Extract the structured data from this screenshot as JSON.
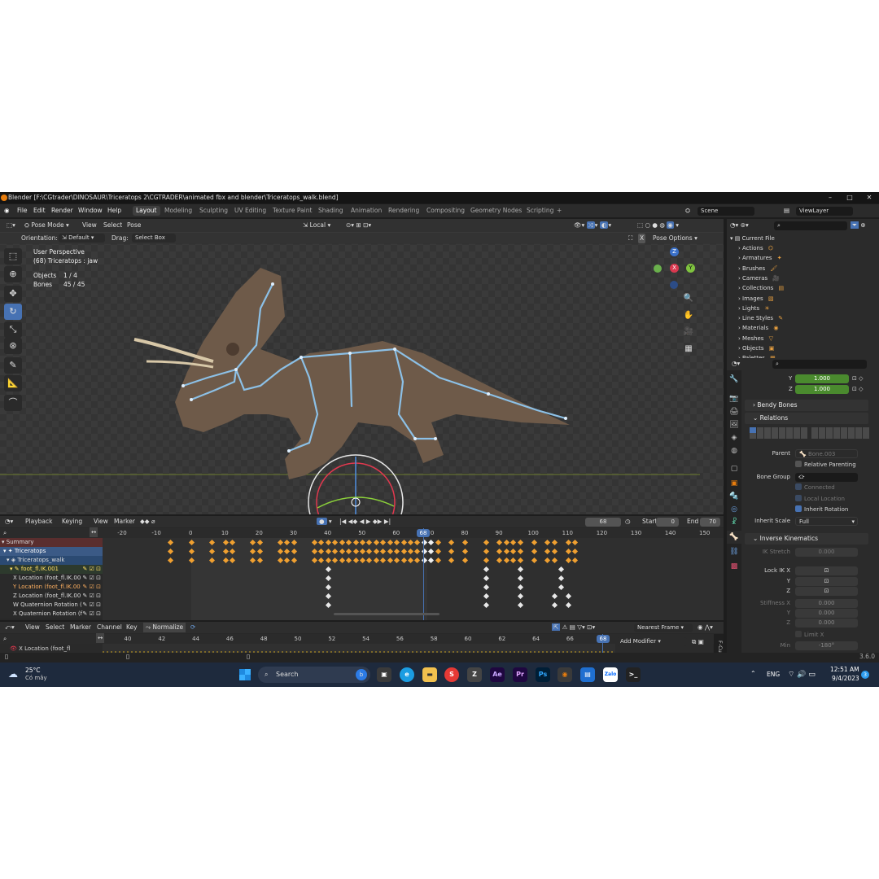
{
  "window": {
    "title": "Blender [F:\\CGtrader\\DINOSAUR\\Triceratops 2\\CGTRADER\\animated fbx and blender\\Triceratops_walk.blend]",
    "min": "–",
    "max": "□",
    "close": "✕"
  },
  "menu": [
    "File",
    "Edit",
    "Render",
    "Window",
    "Help"
  ],
  "workspaces": [
    "Layout",
    "Modeling",
    "Sculpting",
    "UV Editing",
    "Texture Paint",
    "Shading",
    "Animation",
    "Rendering",
    "Compositing",
    "Geometry Nodes",
    "Scripting",
    "+"
  ],
  "scene": {
    "name": "Scene",
    "view_layer": "ViewLayer"
  },
  "viewport": {
    "mode": "Pose Mode",
    "menus": [
      "View",
      "Select",
      "Pose"
    ],
    "transform": "Local",
    "orientation_label": "Orientation:",
    "orientation": "Default",
    "drag_label": "Drag:",
    "drag": "Select Box",
    "pose_options": "Pose Options",
    "x_mirror": "X",
    "overlay": {
      "line1": "User Perspective",
      "line2": "(68) Triceratops : jaw",
      "objects_label": "Objects",
      "objects": "1 / 4",
      "bones_label": "Bones",
      "bones": "45 / 45"
    },
    "gizmo": {
      "x": "X",
      "y": "Y",
      "z": "Z"
    }
  },
  "timeline": {
    "menus": [
      "Playback",
      "Keying",
      "View",
      "Marker"
    ],
    "current": "68",
    "start_label": "Start",
    "start": "0",
    "end_label": "End",
    "end": "70",
    "ruler": [
      "-20",
      "-10",
      "0",
      "10",
      "20",
      "30",
      "40",
      "50",
      "60",
      "70",
      "80",
      "90",
      "100",
      "110",
      "120",
      "130",
      "140",
      "150"
    ],
    "frame_badge": "68",
    "channels": [
      {
        "label": "Summary",
        "color": "#ddd",
        "bg": "#5a2e2e"
      },
      {
        "label": "Triceratops",
        "color": "#fff",
        "bg": "#3b5a86"
      },
      {
        "label": "Triceratops_walk",
        "color": "#ddd",
        "bg": "#2b4a72"
      },
      {
        "label": "foot_fl.IK.001",
        "color": "#ffe066",
        "bg": "#2d3a2d"
      },
      {
        "label": "X Location (foot_fl.IK.00",
        "color": "#ddd",
        "bg": "#2a2a2a"
      },
      {
        "label": "Y Location (foot_fl.IK.00",
        "color": "#ffb060",
        "bg": "#2a2a2a"
      },
      {
        "label": "Z Location (foot_fl.IK.00",
        "color": "#ddd",
        "bg": "#2a2a2a"
      },
      {
        "label": "W Quaternion Rotation (",
        "color": "#ddd",
        "bg": "#2a2a2a"
      },
      {
        "label": "X Quaternion Rotation (f",
        "color": "#ddd",
        "bg": "#2a2a2a"
      }
    ]
  },
  "graph": {
    "menus": [
      "View",
      "Select",
      "Marker",
      "Channel",
      "Key"
    ],
    "normalize": "Normalize",
    "snap": "Nearest Frame",
    "ruler": [
      "40",
      "42",
      "44",
      "46",
      "48",
      "50",
      "52",
      "54",
      "56",
      "58",
      "60",
      "62",
      "64",
      "66"
    ],
    "frame_badge": "68",
    "channel": "X Location (foot_fl",
    "add_modifier": "Add Modifier",
    "side_tab": "F-Cu"
  },
  "outliner": {
    "root": "Current File",
    "items": [
      "Actions",
      "Armatures",
      "Brushes",
      "Cameras",
      "Collections",
      "Images",
      "Lights",
      "Line Styles",
      "Materials",
      "Meshes",
      "Objects",
      "Palettes"
    ]
  },
  "properties": {
    "y_label": "Y",
    "y_value": "1.000",
    "z_label": "Z",
    "z_value": "1.000",
    "bendy": "Bendy Bones",
    "relations": "Relations",
    "parent_label": "Parent",
    "parent": "Bone.003",
    "relative_parenting": "Relative Parenting",
    "bone_group_label": "Bone Group",
    "connected": "Connected",
    "local_location": "Local Location",
    "inherit_rotation": "Inherit Rotation",
    "inherit_scale_label": "Inherit Scale",
    "inherit_scale": "Full",
    "ik": "Inverse Kinematics",
    "ik_stretch_label": "IK Stretch",
    "ik_stretch": "0.000",
    "lock_ik_label": "Lock IK X",
    "lock_y": "Y",
    "lock_z": "Z",
    "stiffness_label": "Stiffness X",
    "stiffness_x": "0.000",
    "stiffness_y_label": "Y",
    "stiffness_y": "0.000",
    "stiffness_z_label": "Z",
    "stiffness_z": "0.000",
    "limit_x": "Limit X",
    "min_label": "Min",
    "min": "-180°"
  },
  "status": {
    "version": "3.6.0"
  },
  "taskbar": {
    "weather_temp": "25°C",
    "weather_desc": "Có mây",
    "search": "Search",
    "lang": "ENG",
    "time": "12:51 AM",
    "date": "9/4/2023",
    "notif": "3"
  }
}
